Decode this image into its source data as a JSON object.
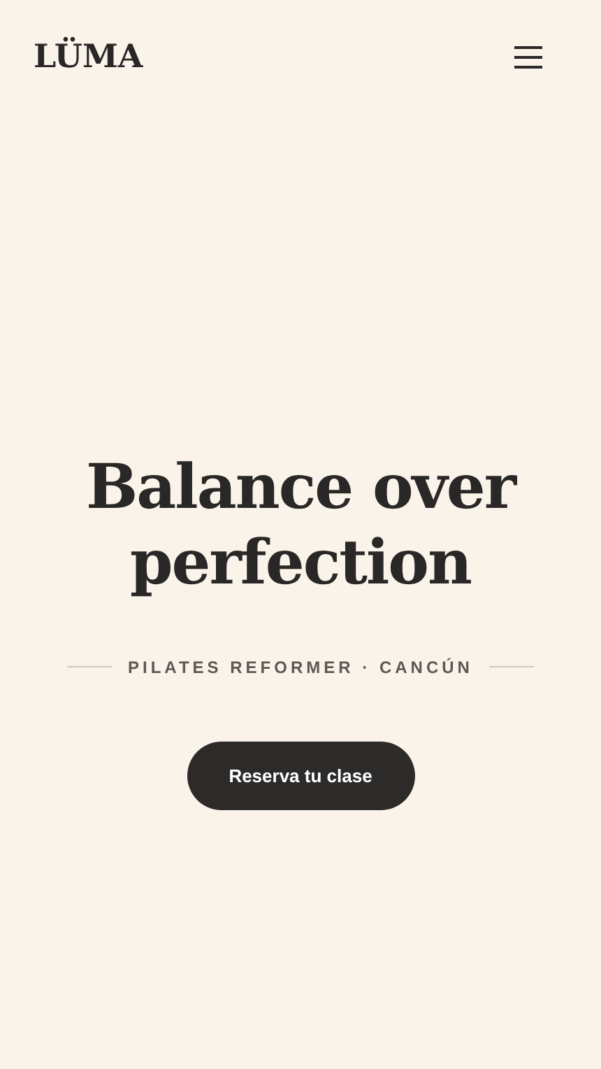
{
  "header": {
    "logo": "LÜMA"
  },
  "hero": {
    "title": "Balance over perfection",
    "tagline": "PILATES REFORMER · CANCÚN",
    "cta": "Reserva tu clase"
  }
}
